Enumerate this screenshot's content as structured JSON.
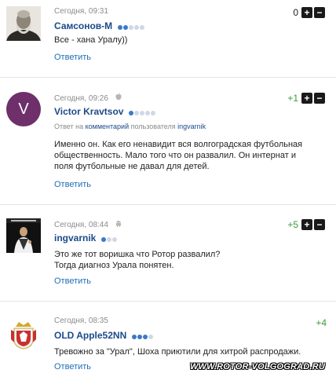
{
  "comments": [
    {
      "time": "Сегодня, 09:31",
      "author": "Самсонов-М",
      "rating_dots": {
        "on": 2,
        "off": 3
      },
      "text_lines": [
        "Все - хана Уралу))"
      ],
      "answer": "Ответить",
      "score": "0",
      "avatar": "portrait-photo"
    },
    {
      "time": "Сегодня, 09:26",
      "platform_icon": "apple-icon",
      "author": "Victor Kravtsov",
      "rating_dots": {
        "on": 1,
        "off": 4
      },
      "reply_prefix": "Ответ на",
      "reply_link": "комментарий",
      "reply_middle": "пользователя",
      "reply_user": "ingvarnik",
      "text_lines": [
        "Именно он. Как его ненавидит вся волгоградская футбольная",
        "общественность. Мало того что он развалил. Он интернат и",
        "поля футбольные не давал для детей."
      ],
      "answer": "Ответить",
      "score": "+1",
      "avatar_letter": "V"
    },
    {
      "time": "Сегодня, 08:44",
      "platform_icon": "android-icon",
      "author": "ingvarnik",
      "rating_dots": {
        "on": 1,
        "off": 2
      },
      "text_lines": [
        "Это же тот воришка что Ротор развалил?",
        "Тогда диагноз Урала понятен."
      ],
      "answer": "Ответить",
      "score": "+5",
      "avatar": "performer-photo"
    },
    {
      "time": "Сегодня, 08:35",
      "author": "OLD Apple52NN",
      "rating_dots": {
        "on": 3,
        "off": 1
      },
      "text_lines": [
        "Тревожно за \"Урал\", Шоха приютили для хитрой распродажи."
      ],
      "answer": "Ответить",
      "score": "+4",
      "avatar": "coat-of-arms"
    }
  ],
  "vote_plus": "+",
  "vote_minus": "−",
  "watermark": "WWW.ROTOR-VOLGOGRAD.RU",
  "colors": {
    "author": "#1c4a8a",
    "link": "#1c6fb5",
    "positive": "#3a9a3a",
    "avatar_v": "#6e2f6a"
  }
}
